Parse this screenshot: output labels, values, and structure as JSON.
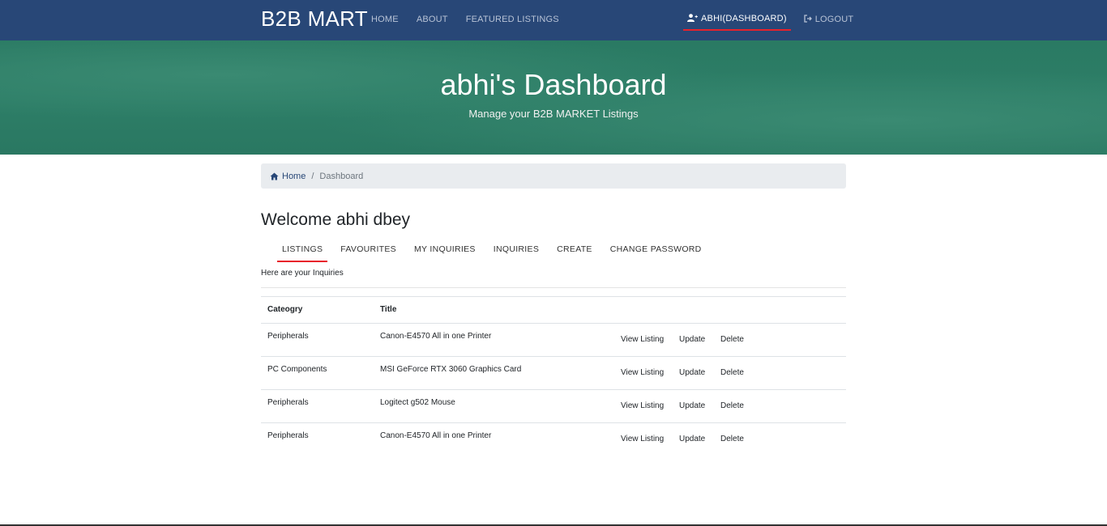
{
  "navbar": {
    "brand": "B2B MART",
    "links": [
      "HOME",
      "ABOUT",
      "FEATURED LISTINGS"
    ],
    "user_link": "ABHI(DASHBOARD)",
    "logout": "LOGOUT"
  },
  "hero": {
    "title": "abhi's Dashboard",
    "subtitle": "Manage your B2B MARKET Listings"
  },
  "breadcrumb": {
    "home": "Home",
    "current": "Dashboard"
  },
  "welcome": "Welcome abhi dbey",
  "tabs": [
    "LISTINGS",
    "FAVOURITES",
    "MY INQUIRIES",
    "INQUIRIES",
    "CREATE",
    "CHANGE PASSWORD"
  ],
  "active_tab": "LISTINGS",
  "intro": "Here are your Inquiries",
  "table": {
    "headers": [
      "Cateogry",
      "Title"
    ],
    "rows": [
      {
        "category": "Peripherals",
        "title": "Canon-E4570 All in one Printer",
        "view": "View Listing",
        "update": "Update",
        "delete": "Delete"
      },
      {
        "category": "PC Components",
        "title": "MSI GeForce RTX 3060 Graphics Card",
        "view": "View Listing",
        "update": "Update",
        "delete": "Delete"
      },
      {
        "category": "Peripherals",
        "title": "Logitect g502 Mouse",
        "view": "View Listing",
        "update": "Update",
        "delete": "Delete"
      },
      {
        "category": "Peripherals",
        "title": "Canon-E4570 All in one Printer",
        "view": "View Listing",
        "update": "Update",
        "delete": "Delete"
      }
    ]
  },
  "colors": {
    "navbar": "#284777",
    "hero": "#2d7e67",
    "accent_underline": "#e8212b"
  },
  "icons": {
    "user": "user-plus-icon",
    "logout": "logout-icon",
    "home": "home-icon"
  }
}
